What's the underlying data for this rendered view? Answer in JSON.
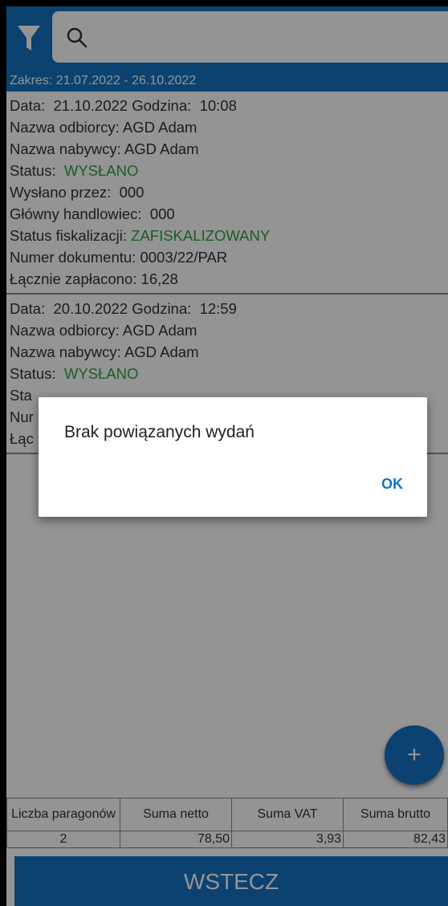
{
  "colors": {
    "primary": "#1473c2",
    "status_green": "#2ea043"
  },
  "header": {
    "filter_icon": "filter-icon",
    "search_icon": "search-icon",
    "search_value": "",
    "range_text": "Zakres: 21.07.2022 - 26.10.2022"
  },
  "receipts": [
    {
      "data_label": "Data:",
      "data_value": "21.10.2022",
      "time_label": "Godzina:",
      "time_value": "10:08",
      "recipient_label": "Nazwa odbiorcy:",
      "recipient_value": "AGD Adam",
      "buyer_label": "Nazwa nabywcy:",
      "buyer_value": "AGD Adam",
      "status_label": "Status:",
      "status_value": "WYSŁANO",
      "sent_by_label": "Wysłano przez:",
      "sent_by_value": "000",
      "main_trader_label": "Główny handlowiec:",
      "main_trader_value": "000",
      "fiscal_label": "Status fiskalizacji:",
      "fiscal_value": "ZAFISKALIZOWANY",
      "doc_no_label": "Numer dokumentu:",
      "doc_no_value": "0003/22/PAR",
      "paid_label": "Łącznie zapłacono:",
      "paid_value": "16,28"
    },
    {
      "data_label": "Data:",
      "data_value": "20.10.2022",
      "time_label": "Godzina:",
      "time_value": "12:59",
      "recipient_label": "Nazwa odbiorcy:",
      "recipient_value": "AGD Adam",
      "buyer_label": "Nazwa nabywcy:",
      "buyer_value": "AGD Adam",
      "status_label": "Status:",
      "status_value": "WYSŁANO",
      "partial_line_1": "Sta",
      "partial_line_2": "Nur",
      "partial_line_3": "Łąc"
    }
  ],
  "summary": {
    "headers": [
      "Liczba paragonów",
      "Suma netto",
      "Suma VAT",
      "Suma brutto"
    ],
    "values": [
      "2",
      "78,50",
      "3,93",
      "82,43"
    ]
  },
  "back_button": "WSTECZ",
  "fab_label": "+",
  "dialog": {
    "message": "Brak powiązanych wydań",
    "ok": "OK"
  }
}
